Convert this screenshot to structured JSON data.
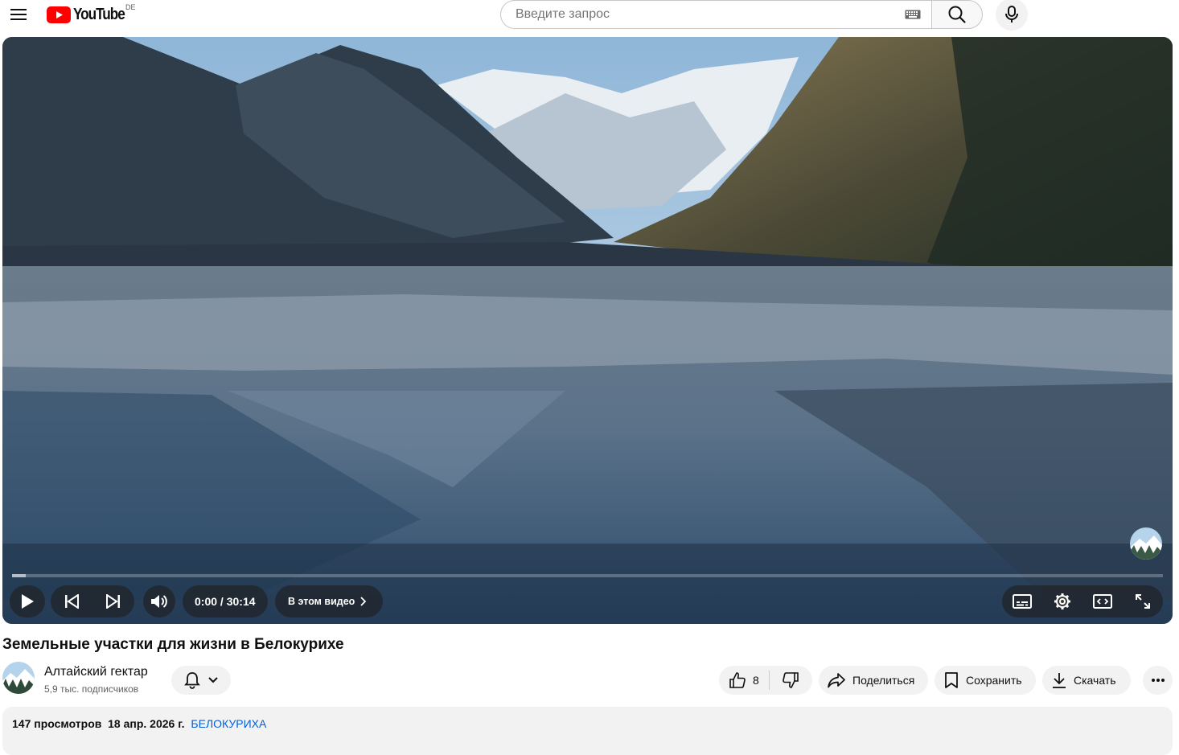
{
  "masthead": {
    "logo_text": "YouTube",
    "country_code": "DE",
    "search_placeholder": "Введите запрос"
  },
  "player": {
    "time_current": "0:00",
    "time_separator": " / ",
    "time_total": "30:14",
    "progress_fraction": 0.012,
    "chapters_label": "В этом видео"
  },
  "video": {
    "title": "Земельные участки для жизни в Белокурихе"
  },
  "channel": {
    "name": "Алтайский гектар",
    "subscribers": "5,9 тыс. подписчиков"
  },
  "actions": {
    "like_count": "8",
    "share_label": "Поделиться",
    "save_label": "Сохранить",
    "download_label": "Скачать"
  },
  "description": {
    "views": "147 просмотров",
    "date": "18 апр. 2026 г.",
    "hashtag": "БЕЛОКУРИХА"
  },
  "colors": {
    "brand_red": "#ff0000",
    "link_blue": "#065fd4",
    "chip_bg": "#f2f2f2"
  }
}
